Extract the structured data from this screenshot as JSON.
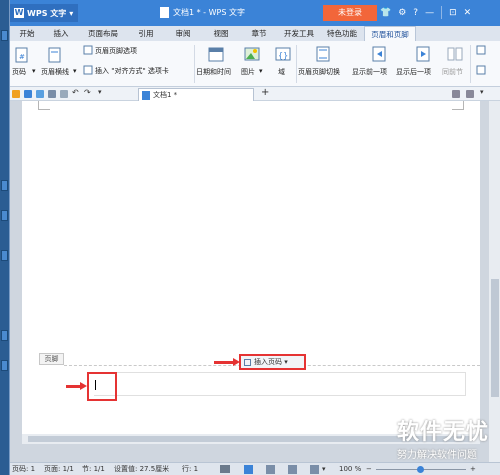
{
  "titlebar": {
    "app_name": "WPS 文字",
    "doc_title": "文档1 * - WPS 文字",
    "login_label": "未登录",
    "icons": [
      "shirt-icon",
      "gear-icon",
      "help-icon",
      "minimize-icon",
      "maximize-icon",
      "close-icon"
    ]
  },
  "tabs": [
    {
      "label": "开始"
    },
    {
      "label": "插入"
    },
    {
      "label": "页面布局"
    },
    {
      "label": "引用"
    },
    {
      "label": "审阅"
    },
    {
      "label": "视图"
    },
    {
      "label": "章节"
    },
    {
      "label": "开发工具"
    },
    {
      "label": "特色功能"
    },
    {
      "label": "页眉和页脚"
    }
  ],
  "ribbon": {
    "page_number": "页码",
    "header_line": "页眉横线",
    "hf_options": "页眉页脚选项",
    "insert_align_tab": "插入 \"对齐方式\" 选项卡",
    "datetime": "日期和时间",
    "picture": "图片",
    "field": "域",
    "hf_switch": "页眉页脚切换",
    "show_prev": "显示前一项",
    "show_next": "显示后一项",
    "same_as_prev": "同前节"
  },
  "quickaccess": {
    "doc_tab": "文档1 *",
    "add_tab": "+"
  },
  "document": {
    "footer_label": "页脚",
    "insert_page_num_btn": "插入页码"
  },
  "watermark": {
    "line1": "软件无忧",
    "line2": "努力解决软件问题"
  },
  "status": {
    "page": "页码: 1",
    "pages": "页面: 1/1",
    "section": "节: 1/1",
    "setting": "设置值: 27.5厘米",
    "row": "行: 1",
    "zoom": "100 %",
    "zoom_percent": 100
  },
  "colors": {
    "accent": "#3b83d7",
    "login": "#f2663a",
    "highlight": "#e53333"
  }
}
